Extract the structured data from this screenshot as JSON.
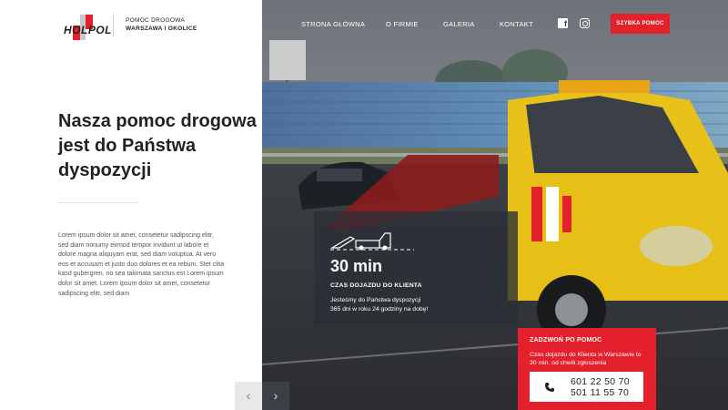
{
  "brand": {
    "logo_text": "HOLPOL",
    "tagline_line1": "POMOC DROGOWA",
    "tagline_line2": "WARSZAWA I OKOLICE",
    "red": "#e3202b"
  },
  "nav": {
    "items": [
      "STRONA GŁÓWNA",
      "O FIRMIE",
      "GALERIA",
      "KONTAKT"
    ],
    "facebook_icon": "facebook-icon",
    "instagram_icon": "instagram-icon",
    "cta_label": "SZYBKA POMOC"
  },
  "hero": {
    "headline_prefix": "Nasza",
    "headline_bold": "pomoc drogowa",
    "headline_rest": "jest do Państwa dyspozycji",
    "body": "Lorem ipsum dolor sit amet, consetetur sadipscing elitr, sed diam nonumy eirmod tempor invidunt ut labore et dolore magna aliquyam erat, sed diam voluptua. At vero eos et accusam et justo duo dolores et ea rebum. Stet clita kasd gubergren, no sea takimata sanctus est Lorem ipsum dolor sit amet. Lorem ipsum dolor sit amet, consetetur sadipscing elitr, sed diam"
  },
  "info": {
    "time": "30 min",
    "label": "CZAS DOJAZDU DO KLIENTA",
    "text_line1": "Jesteśmy do Państwa dyspozycji",
    "text_line2": "365 dni w roku 24 godziny na dobę!",
    "icon": "tow-truck-icon"
  },
  "call": {
    "title": "ZADZWOŃ PO POMOC",
    "text": "Czas dojazdu do Klienta w Warszawie to 30 min. od chwili zgłoszenia",
    "phone1": "601 22 50 70",
    "phone2": "501 11 55 70",
    "icon": "phone-icon"
  },
  "slider": {
    "prev": "‹",
    "next": "›"
  }
}
